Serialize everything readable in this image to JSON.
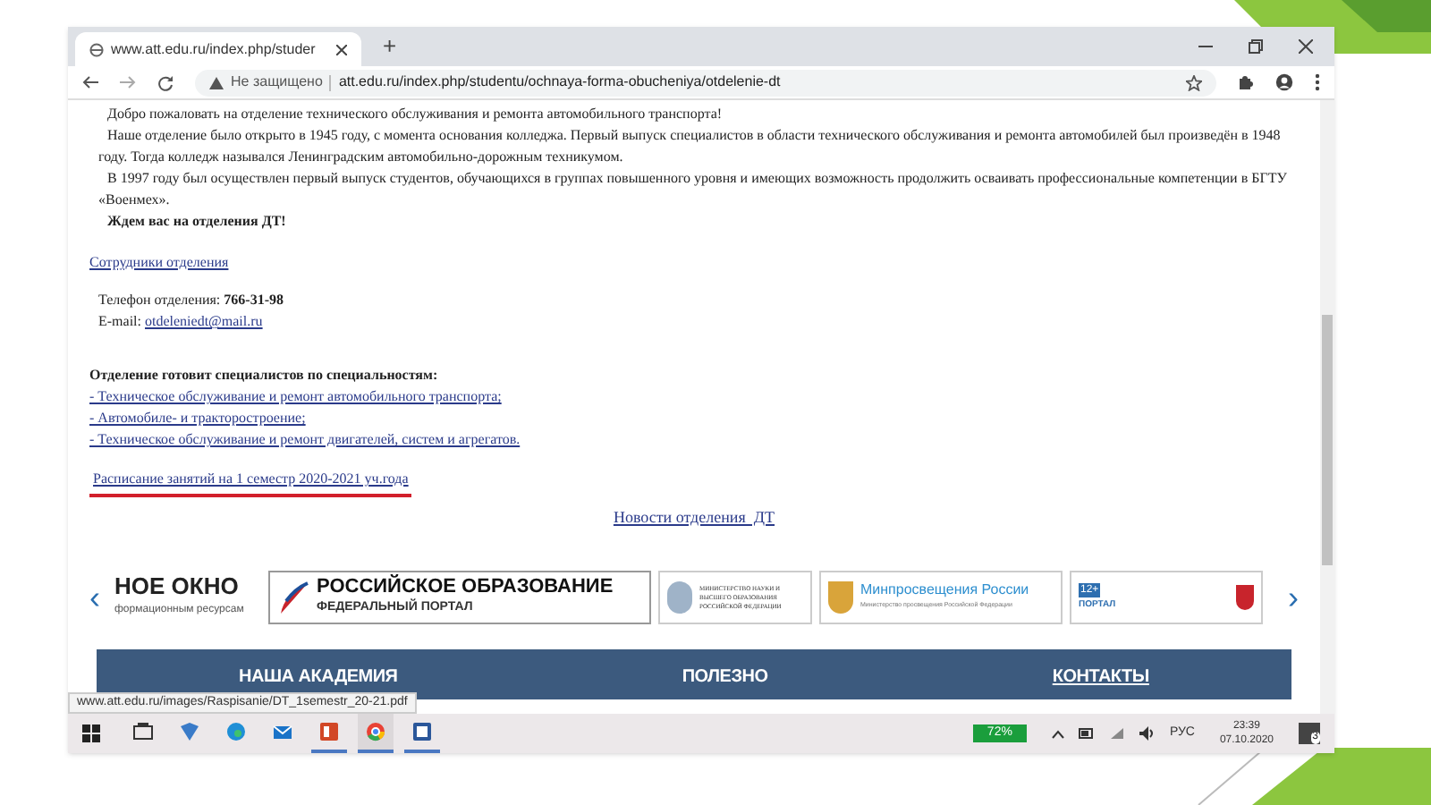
{
  "browser": {
    "tab_title": "www.att.edu.ru/index.php/studer",
    "new_tab": "+",
    "security": "Не защищено",
    "url": "att.edu.ru/index.php/studentu/ochnaya-forma-obucheniya/otdelenie-dt"
  },
  "page": {
    "paragraphs": [
      {
        "kind": "text",
        "text": "Добро пожаловать на отделение технического обслуживания и ремонта автомобильного транспорта!"
      },
      {
        "kind": "text",
        "text": "Наше отделение было открыто в 1945 году, с момента основания колледжа. Первый выпуск специалистов в области технического обслуживания и ремонта автомобилей был произведён в 1948 году. Тогда колледж назывался Ленинградским автомобильно-дорожным техникумом."
      },
      {
        "kind": "text",
        "text": "В 1997 году был осуществлен первый выпуск студентов, обучающихся в группах повышенного уровня и имеющих возможность продолжить осваивать профессиональные компетенции в БГТУ «Военмех»."
      },
      {
        "kind": "bold",
        "text": "Ждем вас на отделения ДТ!"
      }
    ],
    "staff_link": "Сотрудники отделения",
    "phone": {
      "label": "Телефон отделения:",
      "value": "766-31-98"
    },
    "email": {
      "label": "E-mail:",
      "value": "otdeleniedt@mail.ru"
    },
    "specialties": {
      "heading": "Отделение готовит специалистов по специальностям:",
      "items": [
        "- Техническое обслуживание и ремонт автомобильного транспорта;",
        "- Автомобиле- и тракторостроение;",
        "- Техническое обслуживание и ремонт двигателей, систем и агрегатов."
      ]
    },
    "schedule_link": {
      "text": "Расписание занятий на 1 семестр 2020-2021 уч.года",
      "underlined_in_red": true
    },
    "news_link": "Новости отделения  ДТ",
    "banners": [
      {
        "kind": "okno",
        "title": "НОЕ ОКНО",
        "subtitle": "формационным ресурсам"
      },
      {
        "kind": "portal",
        "title": "РОССИЙСКОЕ ОБРАЗОВАНИЕ",
        "subtitle": "ФЕДЕРАЛЬНЫЙ ПОРТАЛ"
      },
      {
        "kind": "ministry",
        "title": "МИНИСТЕРСТВО НАУКИ И ВЫСШЕГО ОБРАЗОВАНИЯ РОССИЙСКОЙ ФЕДЕРАЦИИ"
      },
      {
        "kind": "minpros",
        "title": "Минпросвещения России",
        "subtitle": "Министерство просвещения Российской Федерации"
      },
      {
        "kind": "spo",
        "badge": "12+",
        "title": "ПОРТАЛ"
      }
    ],
    "carousel_prev": "‹",
    "carousel_next": "›",
    "footer": [
      "НАША АКАДЕМИЯ",
      "ПОЛЕЗНО",
      "КОНТАКТЫ"
    ]
  },
  "status_url": "www.att.edu.ru/images/Raspisanie/DT_1semestr_20-21.pdf",
  "taskbar": {
    "apps": [
      {
        "kind": "taskview",
        "running": false,
        "selected": false
      },
      {
        "kind": "files",
        "running": false,
        "selected": false
      },
      {
        "kind": "edge",
        "running": false,
        "selected": false
      },
      {
        "kind": "mail",
        "running": false,
        "selected": false
      },
      {
        "kind": "powerpoint",
        "running": true,
        "selected": false
      },
      {
        "kind": "chrome",
        "running": true,
        "selected": true
      },
      {
        "kind": "word",
        "running": true,
        "selected": false
      }
    ],
    "battery": "72%",
    "language": "РУС",
    "time": "23:39",
    "date": "07.10.2020",
    "notifications": "3"
  }
}
